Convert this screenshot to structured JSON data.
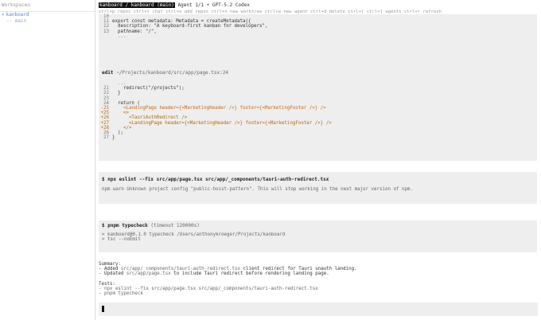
{
  "sidebar": {
    "header": "Workspaces",
    "items": [
      {
        "label": "kanboard",
        "caret": "▾"
      },
      {
        "label": "-- main"
      }
    ]
  },
  "topbar": {
    "highlight": "kanboard / kanboard (main)",
    "title": "  Agent 1/1 • GPT-5.2 Codex"
  },
  "shortcuts": "ctrl+p repos  ctrl+t chat  ctrl+o add repos  ctrl+n new worktree  ctrl+a new agent  ctrl+d delete  ctrl+[ ctrl+] agents  ctrl+r refresh",
  "block1": {
    "lines": [
      {
        "ln": "10",
        "text": ""
      },
      {
        "ln": "11",
        "text": "export const metadata: Metadata = createMetadata({"
      },
      {
        "ln": "12",
        "text": "  description: \"A keyboard-first kanban for developers\","
      },
      {
        "ln": "13",
        "text": "  pathname: \"/\","
      },
      {
        "ln": "",
        "text": "  ..."
      }
    ]
  },
  "edit_block": {
    "label": "edit",
    "path": "~/Projects/kanboard/src/app/page.tsx:24",
    "lines": [
      {
        "ln": "",
        "text": "  ...",
        "kind": "muted"
      },
      {
        "ln": "21",
        "text": "    redirect(\"/projects\");",
        "kind": "plain"
      },
      {
        "ln": "22",
        "text": "  }",
        "kind": "plain"
      },
      {
        "ln": "23",
        "text": "",
        "kind": "plain"
      },
      {
        "ln": "24",
        "text": "  return (",
        "kind": "plain"
      },
      {
        "ln": "-25",
        "text": "    <LandingPage header={<MarketingHeader />} footer={<MarketingFooter />} />",
        "kind": "rm"
      },
      {
        "ln": "+25",
        "text": "    <>",
        "kind": "add"
      },
      {
        "ln": "+26",
        "text": "      <TauriAuthRedirect />",
        "kind": "add"
      },
      {
        "ln": "+27",
        "text": "      <LandingPage header={<MarketingHeader />} footer={<MarketingFooter />} />",
        "kind": "add"
      },
      {
        "ln": "+28",
        "text": "    </>",
        "kind": "add"
      },
      {
        "ln": "26",
        "text": "  );",
        "kind": "plain"
      },
      {
        "ln": "27",
        "text": "}",
        "kind": "plain"
      }
    ]
  },
  "eslint_block": {
    "command": "$ npx eslint --fix src/app/page.tsx src/app/_components/tauri-auth-redirect.tsx",
    "output": "npm warn Unknown project config \"public-hoist-pattern\". This will stop working in the next major version of npm."
  },
  "pnpm_block": {
    "command": "$ pnpm typecheck",
    "timeout": " (timeout 120000s)",
    "lines": [
      "> kanboard@0.1.0 typecheck /Users/anthonykroeger/Projects/kanboard",
      "> tsc --noEmit"
    ]
  },
  "summary": {
    "title": "Summary:",
    "items": [
      {
        "prefix": "- Added ",
        "path": "src/app/_components/tauri-auth-redirect.tsx",
        "rest": " client redirect for Tauri unauth landing."
      },
      {
        "prefix": "- Updated ",
        "path": "src/app/page.tsx",
        "rest": " to include Tauri redirect before rendering landing page."
      }
    ]
  },
  "tests": {
    "title": "Tests:",
    "items": [
      "- npx eslint --fix src/app/page.tsx src/app/_components/tauri-auth-redirect.tsx",
      "- pnpm typecheck"
    ]
  },
  "input": {
    "value": ""
  }
}
